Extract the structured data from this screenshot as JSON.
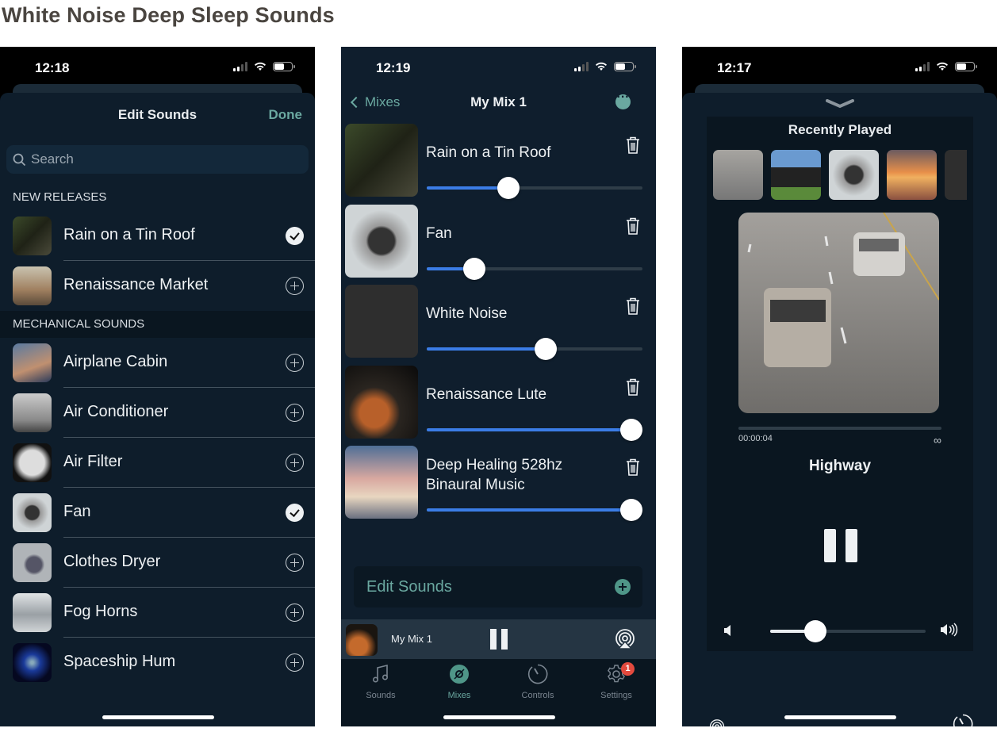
{
  "page_title": "White Noise Deep Sleep Sounds",
  "screen1": {
    "status_time": "12:18",
    "header_title": "Edit Sounds",
    "done_label": "Done",
    "search_placeholder": "Search",
    "sections": [
      {
        "title": "NEW RELEASES",
        "items": [
          {
            "label": "Rain on a Tin Roof",
            "state": "checked",
            "thumb": "rain"
          },
          {
            "label": "Renaissance Market",
            "state": "add",
            "thumb": "market"
          }
        ]
      },
      {
        "title": "MECHANICAL SOUNDS",
        "items": [
          {
            "label": "Airplane Cabin",
            "state": "add",
            "thumb": "airplane"
          },
          {
            "label": "Air Conditioner",
            "state": "add",
            "thumb": "ac"
          },
          {
            "label": "Air Filter",
            "state": "add",
            "thumb": "filter"
          },
          {
            "label": "Fan",
            "state": "checked",
            "thumb": "fan"
          },
          {
            "label": "Clothes Dryer",
            "state": "add",
            "thumb": "dryer"
          },
          {
            "label": "Fog Horns",
            "state": "add",
            "thumb": "fog"
          },
          {
            "label": "Spaceship Hum",
            "state": "add",
            "thumb": "space"
          }
        ]
      }
    ]
  },
  "screen2": {
    "status_time": "12:19",
    "back_label": "Mixes",
    "title": "My Mix 1",
    "mix_items": [
      {
        "label": "Rain on a Tin Roof",
        "volume": 0.38,
        "thumb": "rain"
      },
      {
        "label": "Fan",
        "volume": 0.22,
        "thumb": "fan"
      },
      {
        "label": "White Noise",
        "volume": 0.55,
        "thumb": "noise"
      },
      {
        "label": "Renaissance Lute",
        "volume": 1.0,
        "thumb": "lute"
      },
      {
        "label": "Deep Healing 528hz Binaural Music",
        "volume": 1.0,
        "thumb": "tree"
      }
    ],
    "edit_sounds_label": "Edit Sounds",
    "mini_player": {
      "title": "My Mix 1"
    },
    "tabs": [
      {
        "label": "Sounds",
        "icon": "music-note-icon",
        "active": false
      },
      {
        "label": "Mixes",
        "icon": "disc-icon",
        "active": true
      },
      {
        "label": "Controls",
        "icon": "timer-icon",
        "active": false
      },
      {
        "label": "Settings",
        "icon": "gear-icon",
        "active": false,
        "badge": "1"
      }
    ],
    "colors": {
      "accent": "#6aa8a0",
      "slider": "#3b7de6",
      "badge": "#e34a3e"
    }
  },
  "screen3": {
    "status_time": "12:17",
    "recently_played_title": "Recently Played",
    "recent": [
      "highway",
      "train",
      "fan",
      "sunset",
      "noise"
    ],
    "elapsed": "00:00:04",
    "duration_symbol": "∞",
    "track_title": "Highway",
    "volume": 0.29
  }
}
